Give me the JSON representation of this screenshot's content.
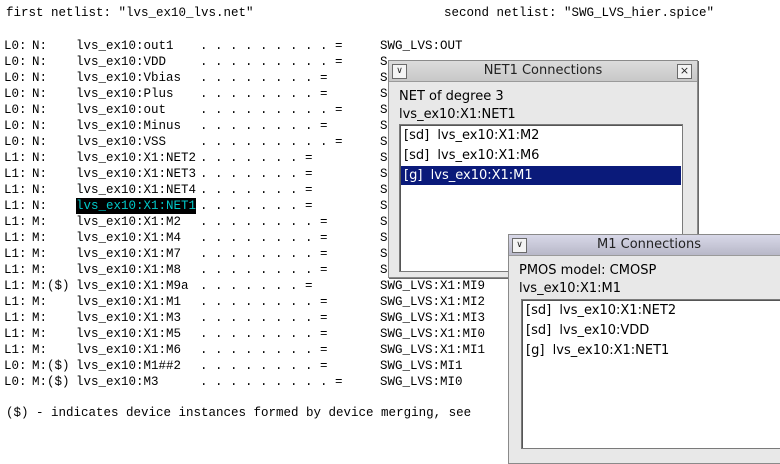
{
  "header": {
    "first_netlist": "first netlist: \"lvs_ex10_lvs.net\"",
    "second_netlist": "second netlist: \"SWG_LVS_hier.spice\""
  },
  "rows": [
    {
      "lvl": "L0:",
      "typ": "N:",
      "net": "lvs_ex10:out1",
      "dots": ". . . . . . . . . =",
      "rhs": "SWG_LVS:OUT"
    },
    {
      "lvl": "L0:",
      "typ": "N:",
      "net": "lvs_ex10:VDD",
      "dots": ". . . . . . . . . =",
      "rhs": "S"
    },
    {
      "lvl": "L0:",
      "typ": "N:",
      "net": "lvs_ex10:Vbias",
      "dots": ". . . . . . . . =",
      "rhs": "S"
    },
    {
      "lvl": "L0:",
      "typ": "N:",
      "net": "lvs_ex10:Plus",
      "dots": ". . . . . . . . =",
      "rhs": "S"
    },
    {
      "lvl": "L0:",
      "typ": "N:",
      "net": "lvs_ex10:out",
      "dots": ". . . . . . . . . =",
      "rhs": "S"
    },
    {
      "lvl": "L0:",
      "typ": "N:",
      "net": "lvs_ex10:Minus",
      "dots": ". . . . . . . . =",
      "rhs": "S"
    },
    {
      "lvl": "L0:",
      "typ": "N:",
      "net": "lvs_ex10:VSS",
      "dots": ". . . . . . . . . =",
      "rhs": "S"
    },
    {
      "lvl": "L1:",
      "typ": "N:",
      "net": "lvs_ex10:X1:NET2",
      "dots": ". . . . . . . =",
      "rhs": "S"
    },
    {
      "lvl": "L1:",
      "typ": "N:",
      "net": "lvs_ex10:X1:NET3",
      "dots": ". . . . . . . =",
      "rhs": "S"
    },
    {
      "lvl": "L1:",
      "typ": "N:",
      "net": "lvs_ex10:X1:NET4",
      "dots": ". . . . . . . =",
      "rhs": "S"
    },
    {
      "lvl": "L1:",
      "typ": "N:",
      "net": "lvs_ex10:X1:NET1",
      "dots": ". . . . . . . =",
      "rhs": "S",
      "selected": true
    },
    {
      "lvl": "L1:",
      "typ": "M:",
      "net": "lvs_ex10:X1:M2",
      "dots": ". . . . . . . . =",
      "rhs": "S"
    },
    {
      "lvl": "L1:",
      "typ": "M:",
      "net": "lvs_ex10:X1:M4",
      "dots": ". . . . . . . . =",
      "rhs": "S"
    },
    {
      "lvl": "L1:",
      "typ": "M:",
      "net": "lvs_ex10:X1:M7",
      "dots": ". . . . . . . . =",
      "rhs": "S"
    },
    {
      "lvl": "L1:",
      "typ": "M:",
      "net": "lvs_ex10:X1:M8",
      "dots": ". . . . . . . . =",
      "rhs": "S"
    },
    {
      "lvl": "L1:",
      "typ": "M:($)",
      "net": "lvs_ex10:X1:M9a",
      "dots": ". . . . . . . =",
      "rhs": "SWG_LVS:X1:MI9"
    },
    {
      "lvl": "L1:",
      "typ": "M:",
      "net": "lvs_ex10:X1:M1",
      "dots": ". . . . . . . . =",
      "rhs": "SWG_LVS:X1:MI2"
    },
    {
      "lvl": "L1:",
      "typ": "M:",
      "net": "lvs_ex10:X1:M3",
      "dots": ". . . . . . . . =",
      "rhs": "SWG_LVS:X1:MI3"
    },
    {
      "lvl": "L1:",
      "typ": "M:",
      "net": "lvs_ex10:X1:M5",
      "dots": ". . . . . . . . =",
      "rhs": "SWG_LVS:X1:MI0"
    },
    {
      "lvl": "L1:",
      "typ": "M:",
      "net": "lvs_ex10:X1:M6",
      "dots": ". . . . . . . . =",
      "rhs": "SWG_LVS:X1:MI1"
    },
    {
      "lvl": "L0:",
      "typ": "M:($)",
      "net": "lvs_ex10:M1##2",
      "dots": ". . . . . . . . =",
      "rhs": "SWG_LVS:MI1"
    },
    {
      "lvl": "L0:",
      "typ": "M:($)",
      "net": "lvs_ex10:M3",
      "dots": ". . . . . . . . . =",
      "rhs": "SWG_LVS:MI0"
    }
  ],
  "footnote": "($) - indicates device instances formed by device merging, see",
  "net1_window": {
    "title": "NET1 Connections",
    "degree": "NET of degree 3",
    "name": "lvs_ex10:X1:NET1",
    "items": [
      "[sd]  lvs_ex10:X1:M2",
      "[sd]  lvs_ex10:X1:M6",
      "[g]  lvs_ex10:X1:M1"
    ],
    "selected_index": 2
  },
  "m1_window": {
    "title": "M1 Connections",
    "model": "PMOS model: CMOSP",
    "name": "lvs_ex10:X1:M1",
    "items": [
      "[sd]  lvs_ex10:X1:NET2",
      "[sd]  lvs_ex10:VDD",
      "[g]  lvs_ex10:X1:NET1"
    ]
  },
  "icons": {
    "window_menu": "window-menu-icon",
    "close": "close-icon"
  },
  "colors": {
    "selection_bg": "#0a1a7a",
    "highlight_text": "#00c8c8"
  }
}
